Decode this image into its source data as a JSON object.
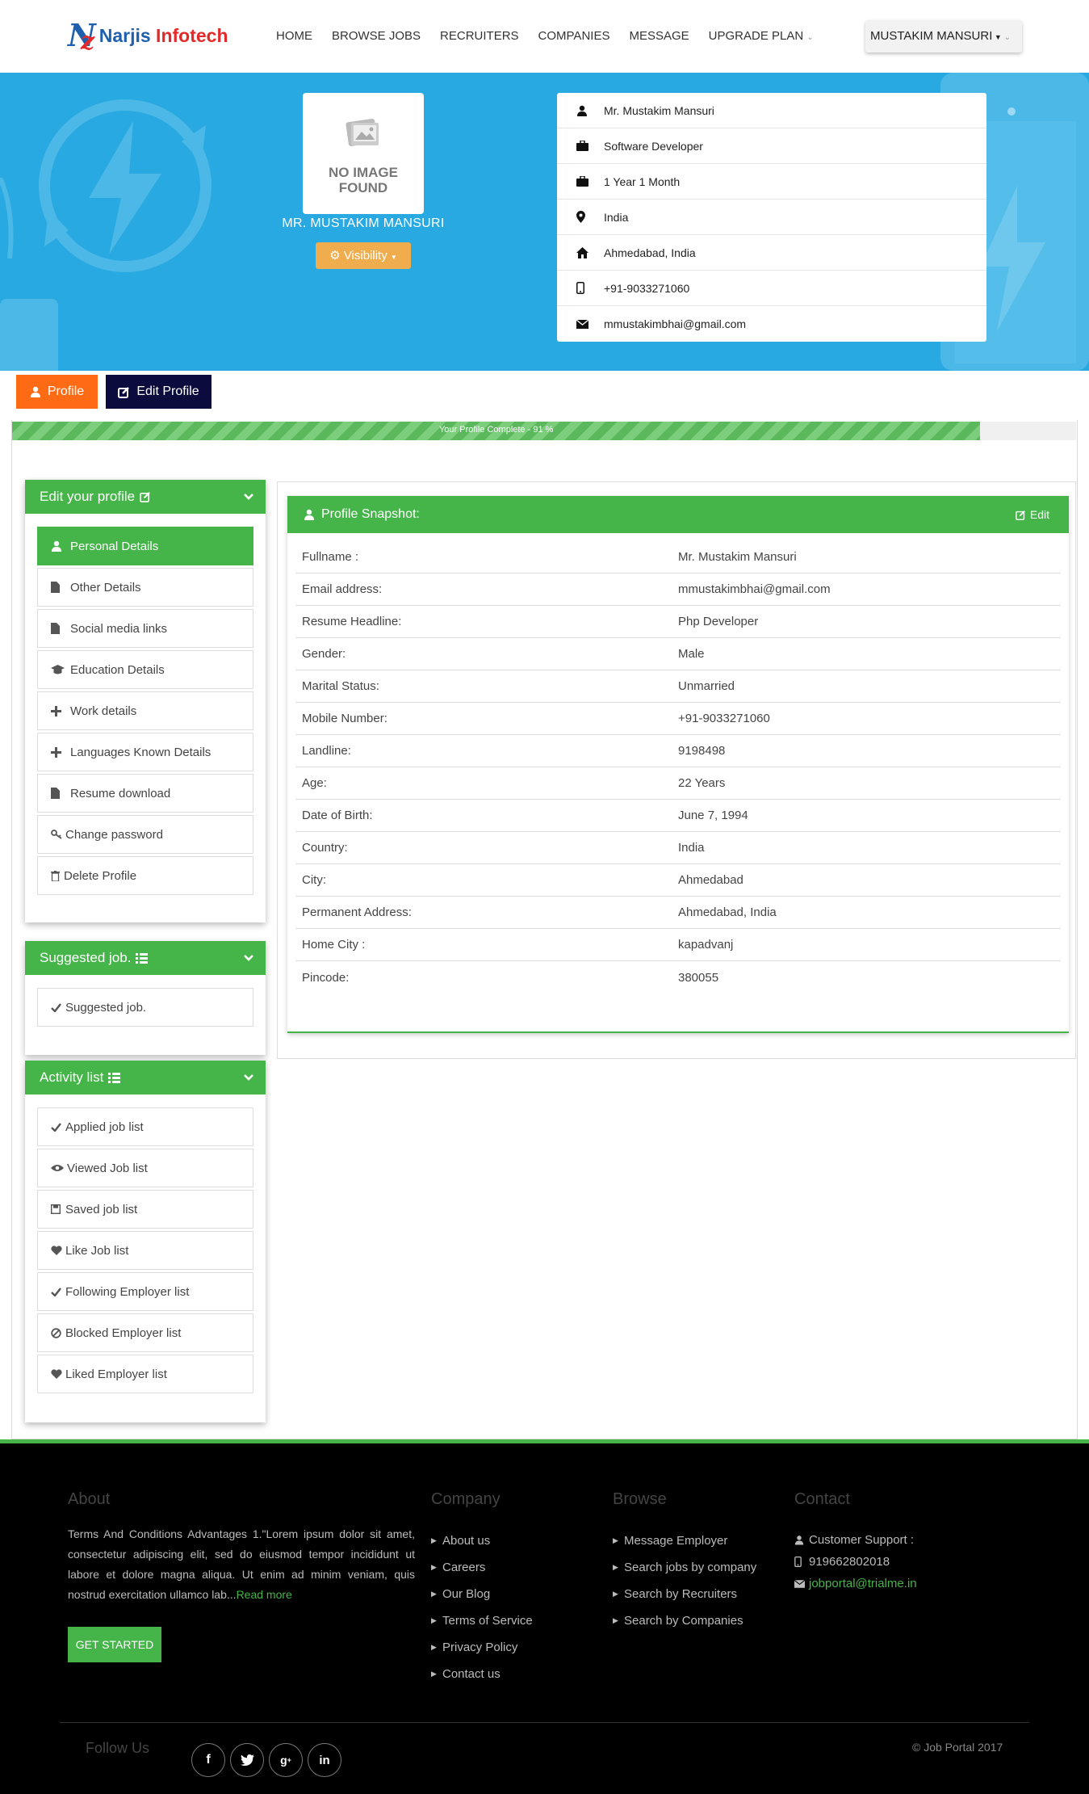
{
  "brand": {
    "logo_text_1": "Narjis",
    "logo_text_2": " Infotech"
  },
  "nav": {
    "items": [
      "HOME",
      "BROWSE JOBS",
      "RECRUITERS",
      "COMPANIES",
      "MESSAGE",
      "UPGRADE PLAN"
    ],
    "user_menu": "MUSTAKIM MANSURI"
  },
  "hero": {
    "photo_placeholder": "NO IMAGE FOUND",
    "name": "MR. MUSTAKIM MANSURI",
    "visibility_label": "Visibility",
    "info": {
      "fullname": "Mr. Mustakim Mansuri",
      "designation": "Software Developer",
      "experience": "1 Year 1 Month",
      "country": "India",
      "location": "Ahmedabad, India",
      "phone": "+91-9033271060",
      "email": "mmustakimbhai@gmail.com"
    }
  },
  "tabs": {
    "profile": "Profile",
    "edit_profile": "Edit Profile"
  },
  "progress": {
    "label": "Your Profile Complete - 91 %",
    "percent": 91
  },
  "sidebar": {
    "edit_profile": {
      "title": "Edit your profile",
      "items": [
        "Personal Details",
        "Other Details",
        "Social media links",
        "Education Details",
        "Work details",
        "Languages Known Details",
        "Resume download",
        "Change password",
        "Delete Profile"
      ]
    },
    "suggested": {
      "title": "Suggested job.",
      "items": [
        "Suggested job."
      ]
    },
    "activity": {
      "title": "Activity list",
      "items": [
        "Applied job list",
        "Viewed Job list",
        "Saved job list",
        "Like Job list",
        "Following Employer list",
        "Blocked Employer list",
        "Liked Employer list"
      ]
    }
  },
  "snapshot": {
    "title": "Profile Snapshot:",
    "edit_label": "Edit",
    "rows": [
      {
        "label": "Fullname :",
        "value": "Mr. Mustakim Mansuri"
      },
      {
        "label": "Email address:",
        "value": "mmustakimbhai@gmail.com"
      },
      {
        "label": "Resume Headline:",
        "value": "Php Developer"
      },
      {
        "label": "Gender:",
        "value": "Male"
      },
      {
        "label": "Marital Status:",
        "value": "Unmarried"
      },
      {
        "label": "Mobile Number:",
        "value": "+91-9033271060"
      },
      {
        "label": "Landline:",
        "value": "9198498"
      },
      {
        "label": "Age:",
        "value": "22 Years"
      },
      {
        "label": "Date of Birth:",
        "value": "June 7, 1994"
      },
      {
        "label": "Country:",
        "value": "India"
      },
      {
        "label": "City:",
        "value": "Ahmedabad"
      },
      {
        "label": "Permanent Address:",
        "value": "Ahmedabad, India"
      },
      {
        "label": "Home City :",
        "value": "kapadvanj"
      },
      {
        "label": "Pincode:",
        "value": "380055"
      }
    ]
  },
  "footer": {
    "about": {
      "title": "About",
      "text": "Terms And Conditions Advantages 1.\"Lorem ipsum dolor sit amet, consectetur adipiscing elit, sed do eiusmod tempor incididunt ut labore et dolore magna aliqua. Ut enim ad minim veniam, quis nostrud exercitation ullamco lab...",
      "read_more": "Read more",
      "cta": "GET STARTED"
    },
    "company": {
      "title": "Company",
      "links": [
        "About us",
        "Careers",
        "Our Blog",
        "Terms of Service",
        "Privacy Policy",
        "Contact us"
      ]
    },
    "browse": {
      "title": "Browse",
      "links": [
        "Message Employer",
        "Search jobs by company",
        "Search by Recruiters",
        "Search by Companies"
      ]
    },
    "contact": {
      "title": "Contact",
      "support_label": "Customer Support :",
      "phone": "919662802018",
      "email": "jobportal@trialme.in"
    },
    "follow_us": "Follow Us",
    "copyright": "© Job Portal 2017"
  },
  "colors": {
    "primary_green": "#45b549",
    "hero_blue": "#29a9e1",
    "orange": "#ff6a14",
    "navy": "#0b0b3d",
    "warning": "#f0ad4e"
  }
}
